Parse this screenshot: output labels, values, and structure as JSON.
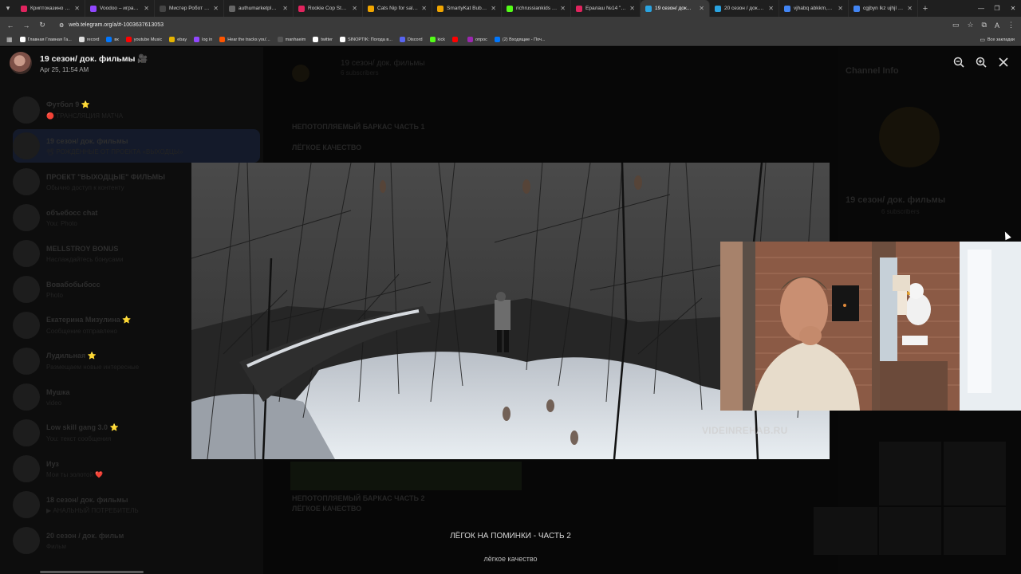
{
  "browser": {
    "tabs": [
      {
        "label": "Криптоказино онл...",
        "color": "#e0245e"
      },
      {
        "label": "Voodoo – играть в...",
        "color": "#9147ff"
      },
      {
        "label": "Мистер Робот (1-4...",
        "color": "#444444"
      },
      {
        "label": "authumarketplace.a...",
        "color": "#666666"
      },
      {
        "label": "Rookie Cop Stumbl...",
        "color": "#e0245e"
      },
      {
        "label": "Cats Nip for sale |...",
        "color": "#f0a500"
      },
      {
        "label": "SmartyKat Bubble T...",
        "color": "#f0a500"
      },
      {
        "label": "richrussiankids Stre...",
        "color": "#53fc18"
      },
      {
        "label": "Ералаш №14 \"Я с...",
        "color": "#e0245e"
      },
      {
        "label": "19 сезон/ док...",
        "color": "#2aa3e0",
        "active": true
      },
      {
        "label": "20 сезон / док.фил...",
        "color": "#2aa3e0"
      },
      {
        "label": "vjhabq abkkm,v - G...",
        "color": "#4285f4"
      },
      {
        "label": "cgjbyn lkz ujhjl - G...",
        "color": "#4285f4"
      }
    ],
    "url": "web.telegram.org/a/#-1003637613053",
    "bookmarks": [
      {
        "label": "Главная Главная Га...",
        "color": "#ffffff"
      },
      {
        "label": "record",
        "color": "#dddddd"
      },
      {
        "label": "вк",
        "color": "#0077ff"
      },
      {
        "label": "youtube Music",
        "color": "#ff0000"
      },
      {
        "label": "ebay",
        "color": "#e5b300"
      },
      {
        "label": "log in",
        "color": "#9147ff"
      },
      {
        "label": "Hear the tracks you'...",
        "color": "#ff5500"
      },
      {
        "label": "manhaeim",
        "color": "#555555"
      },
      {
        "label": "twitter",
        "color": "#ffffff"
      },
      {
        "label": "SINOPTIK: Погода в...",
        "color": "#ffffff"
      },
      {
        "label": "Discord",
        "color": "#5865f2"
      },
      {
        "label": "kick",
        "color": "#53fc18"
      },
      {
        "label": "",
        "color": "#ff0000"
      },
      {
        "label": "опрос",
        "color": "#9c27b0"
      },
      {
        "label": "(2) Входящие - Поч...",
        "color": "#0077ff"
      }
    ],
    "all_bookmarks": "Все закладки"
  },
  "viewer": {
    "channel_title": "19 сезон/ док. фильмы 🎥",
    "date": "Apr 25, 11:54 AM",
    "watermark": "VIDEINREHAB.RU",
    "caption_title": "ЛЁГОК НА ПОМИНКИ - ЧАСТЬ 2",
    "caption_sub": "лёгкое качество"
  },
  "background": {
    "chats": [
      {
        "name": "Футбол 9 ⭐",
        "snip": "🔴 ТРАНСЛЯЦИЯ МАТЧА"
      },
      {
        "name": "19 сезон/ док. фильмы",
        "snip": "📽 РОЖДЁННЫЕ ОТ ПРОЕКТА «ВЫХОДЦЫ»",
        "selected": true
      },
      {
        "name": "ПРОЕКТ \"ВЫХОДЦЫЕ\" ФИЛЬМЫ",
        "snip": "Обычно доступ к контенту"
      },
      {
        "name": "объебосс chat",
        "snip": "You: Photo"
      },
      {
        "name": "MELLSTROY BONUS",
        "snip": "Наслаждайтесь бонусами"
      },
      {
        "name": "Вовабобыбосс",
        "snip": "Photo"
      },
      {
        "name": "Екатерина Мизулина ⭐",
        "snip": "Сообщение отправлено"
      },
      {
        "name": "Лудильная ⭐",
        "snip": "Размещаем новые интересные"
      },
      {
        "name": "Мушка",
        "snip": "video"
      },
      {
        "name": "Low skill gang 3.0 ⭐",
        "snip": "You: текст сообщения"
      },
      {
        "name": "Иуз",
        "snip": "Мои ты золотой ❤️"
      },
      {
        "name": "18 сезон/ док. фильмы",
        "snip": "▶ АНАЛЬНЫЙ ПОТРЕБИТЕЛЬ"
      },
      {
        "name": "20 сезон / док. фильм",
        "snip": "Фильм"
      }
    ],
    "header_title": "19 сезон/ док. фильмы",
    "header_sub": "6 subscribers",
    "msg1_title": "НЕПОТОПЛЯЕМЫЙ БАРКАС ЧАСТЬ 1",
    "msg1_sub": "ЛЁГКОЕ КАЧЕСТВО",
    "msg2_title": "НЕПОТОПЛЯЕМЫЙ БАРКАС ЧАСТЬ 2",
    "msg2_sub": "ЛЁГКОЕ КАЧЕСТВО",
    "right_title": "Channel Info",
    "right_name": "19 сезон/ док. фильмы",
    "right_sub": "6 subscribers"
  }
}
